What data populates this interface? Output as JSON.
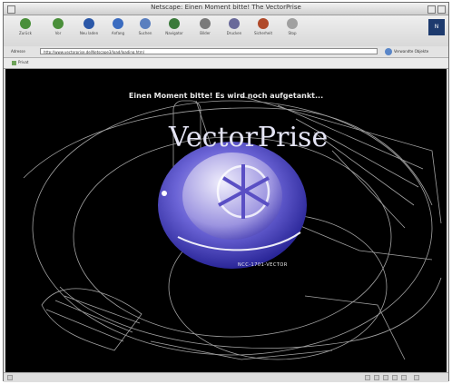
{
  "window": {
    "title": "Netscape: Einen Moment bitte! The VectorPrise"
  },
  "toolbar": {
    "buttons": [
      {
        "label": "Zurück",
        "icon": "back-arrow-icon",
        "color": "#4a8f3a"
      },
      {
        "label": "Vor",
        "icon": "forward-arrow-icon",
        "color": "#4a8f3a"
      },
      {
        "label": "Neu laden",
        "icon": "reload-icon",
        "color": "#2b58a8"
      },
      {
        "label": "Anfang",
        "icon": "home-icon",
        "color": "#3b6cc0"
      },
      {
        "label": "Suchen",
        "icon": "search-icon",
        "color": "#5a7fbf"
      },
      {
        "label": "Navigator",
        "icon": "guide-icon",
        "color": "#3b7a3b"
      },
      {
        "label": "Bilder",
        "icon": "images-icon",
        "color": "#7a7a7a"
      },
      {
        "label": "Drucken",
        "icon": "print-icon",
        "color": "#6a6a9a"
      },
      {
        "label": "Sicherheit",
        "icon": "lock-icon",
        "color": "#b04a2a"
      },
      {
        "label": "Stop",
        "icon": "stop-icon",
        "color": "#a0a0a0"
      }
    ],
    "brand": "N"
  },
  "address": {
    "label": "Adresse",
    "url": "http://www.vectorprise.de/Netscape3/load/loading.html",
    "right_label": "Verwandte Objekte"
  },
  "favorites": {
    "item": "Privat"
  },
  "content": {
    "loading_text": "Einen Moment bitte! Es wird noch aufgetankt...",
    "logo_text": "VectorPrise",
    "caption": "NCC-1701-VECTOR",
    "colors": {
      "background": "#000000",
      "wireframe": "#bfbfbf",
      "logo_blue": "#3a3ab8"
    }
  }
}
